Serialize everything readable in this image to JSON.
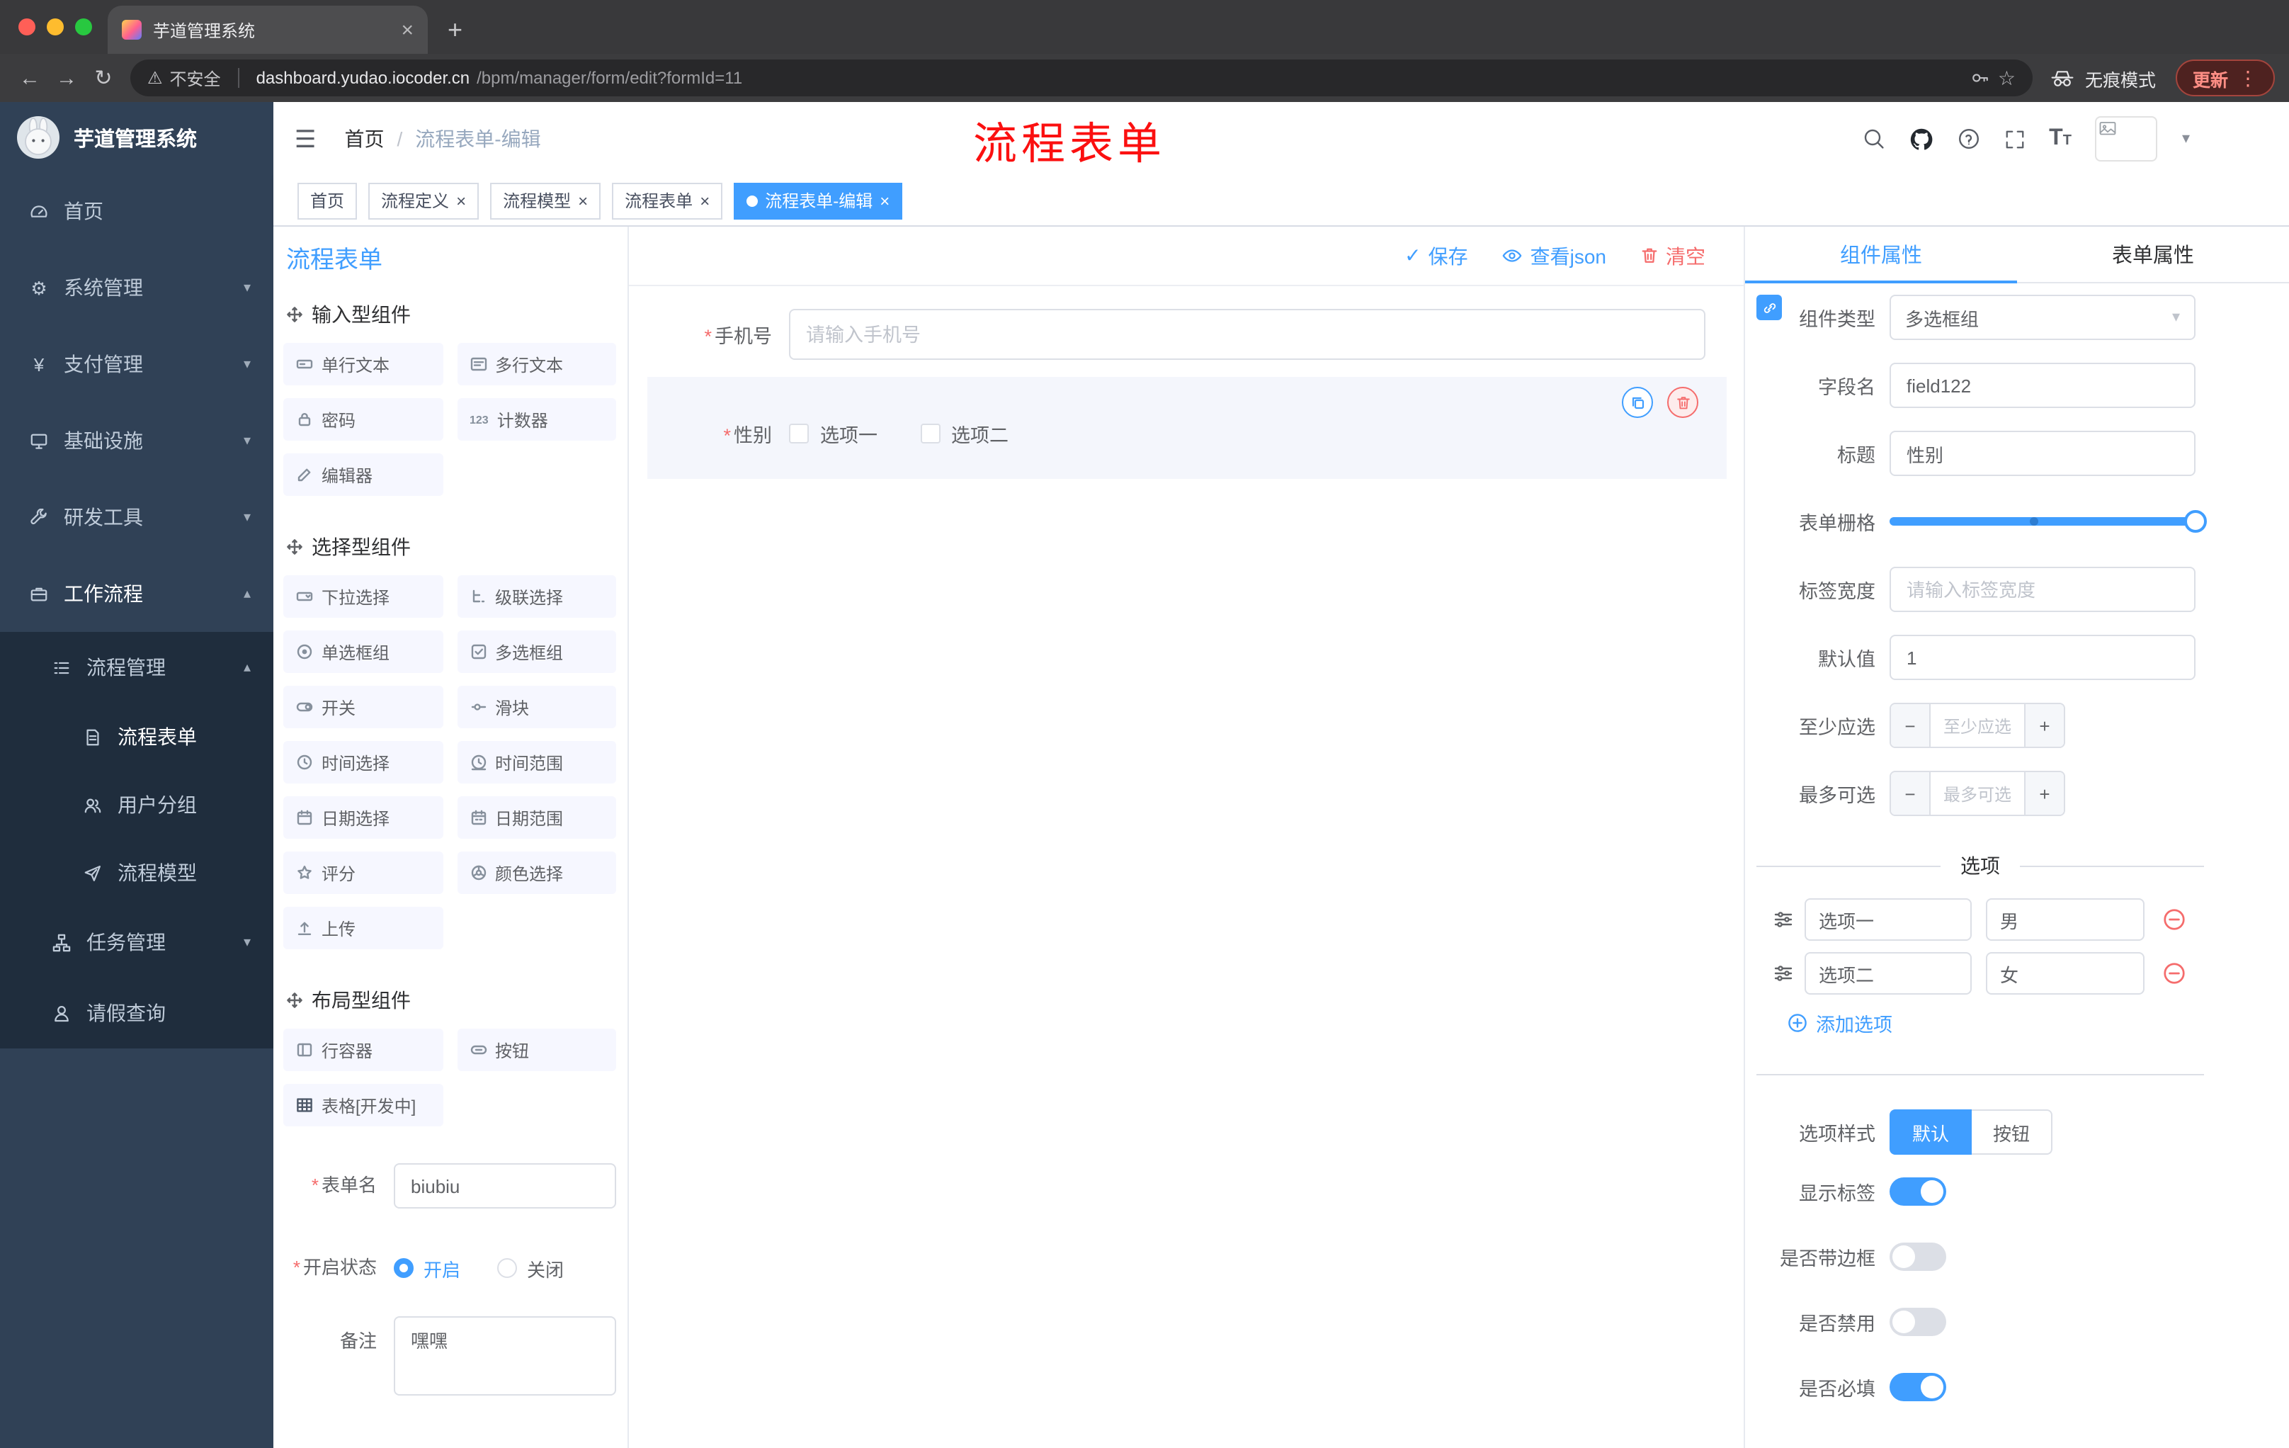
{
  "browser": {
    "tab_title": "芋道管理系统",
    "insecure_label": "不安全",
    "url_domain": "dashboard.yudao.iocoder.cn",
    "url_path": "/bpm/manager/form/edit?formId=11",
    "incognito_label": "无痕模式",
    "update_label": "更新"
  },
  "icons": {
    "close": "×",
    "plus": "+",
    "minus": "−",
    "back": "←",
    "forward": "→",
    "reload": "↻",
    "warning": "⚠",
    "star": "☆",
    "kebab": "⋮",
    "hamburger": "☰",
    "chevron_down": "▾",
    "chevron_up": "▴",
    "check": "✓",
    "yen": "¥",
    "gear": "⚙",
    "counter": "123",
    "required": "*",
    "t_big": "T",
    "t_small": "T"
  },
  "header": {
    "breadcrumb_home": "首页",
    "breadcrumb_sep": "/",
    "breadcrumb_current": "流程表单-编辑",
    "overlay_text": "流程表单"
  },
  "tags": [
    {
      "label": "首页"
    },
    {
      "label": "流程定义"
    },
    {
      "label": "流程模型"
    },
    {
      "label": "流程表单"
    },
    {
      "label": "流程表单-编辑"
    }
  ],
  "sidebar": {
    "title": "芋道管理系统",
    "menu": [
      "首页",
      "系统管理",
      "支付管理",
      "基础设施",
      "研发工具",
      "工作流程"
    ],
    "submenu": {
      "process_mgmt": "流程管理",
      "children": [
        "流程表单",
        "用户分组",
        "流程模型"
      ],
      "task_mgmt": "任务管理",
      "leave_query": "请假查询"
    }
  },
  "palette": {
    "title": "流程表单",
    "sections": [
      {
        "title": "输入型组件",
        "items": [
          "单行文本",
          "多行文本",
          "密码",
          "计数器",
          "编辑器"
        ]
      },
      {
        "title": "选择型组件",
        "items": [
          "下拉选择",
          "级联选择",
          "单选框组",
          "多选框组",
          "开关",
          "滑块",
          "时间选择",
          "时间范围",
          "日期选择",
          "日期范围",
          "评分",
          "颜色选择",
          "上传"
        ]
      },
      {
        "title": "布局型组件",
        "items": [
          "行容器",
          "按钮",
          "表格[开发中]"
        ]
      }
    ],
    "form": {
      "name_label": "表单名",
      "name_value": "biubiu",
      "status_label": "开启状态",
      "status_on": "开启",
      "status_off": "关闭",
      "remark_label": "备注",
      "remark_value": "嘿嘿"
    }
  },
  "canvas": {
    "save": "保存",
    "view_json": "查看json",
    "clear": "清空",
    "phone_label": "手机号",
    "phone_placeholder": "请输入手机号",
    "gender_label": "性别",
    "gender_options": [
      "选项一",
      "选项二"
    ]
  },
  "props": {
    "tab_component": "组件属性",
    "tab_form": "表单属性",
    "type_label": "组件类型",
    "type_value": "多选框组",
    "field_label": "字段名",
    "field_value": "field122",
    "title_label": "标题",
    "title_value": "性别",
    "grid_label": "表单栅格",
    "width_label": "标签宽度",
    "width_placeholder": "请输入标签宽度",
    "default_label": "默认值",
    "default_value": "1",
    "min_label": "至少应选",
    "min_placeholder": "至少应选",
    "max_label": "最多可选",
    "max_placeholder": "最多可选",
    "options_divider": "选项",
    "options": [
      {
        "label": "选项一",
        "value": "男"
      },
      {
        "label": "选项二",
        "value": "女"
      }
    ],
    "add_option": "添加选项",
    "style_label": "选项样式",
    "style_default": "默认",
    "style_button": "按钮",
    "toggles": [
      {
        "label": "显示标签",
        "on": true
      },
      {
        "label": "是否带边框",
        "on": false
      },
      {
        "label": "是否禁用",
        "on": false
      },
      {
        "label": "是否必填",
        "on": true
      }
    ]
  }
}
